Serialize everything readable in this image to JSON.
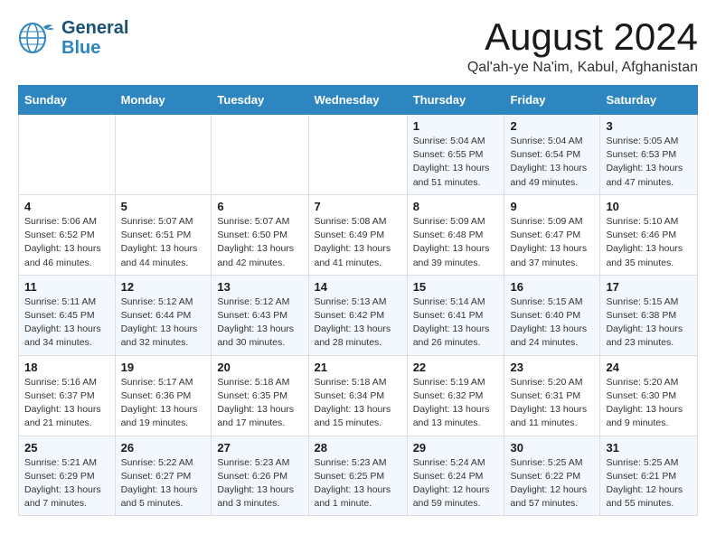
{
  "logo": {
    "line1": "General",
    "line2": "Blue"
  },
  "title": "August 2024",
  "location": "Qal'ah-ye Na'im, Kabul, Afghanistan",
  "weekdays": [
    "Sunday",
    "Monday",
    "Tuesday",
    "Wednesday",
    "Thursday",
    "Friday",
    "Saturday"
  ],
  "weeks": [
    [
      {
        "day": "",
        "info": ""
      },
      {
        "day": "",
        "info": ""
      },
      {
        "day": "",
        "info": ""
      },
      {
        "day": "",
        "info": ""
      },
      {
        "day": "1",
        "info": "Sunrise: 5:04 AM\nSunset: 6:55 PM\nDaylight: 13 hours\nand 51 minutes."
      },
      {
        "day": "2",
        "info": "Sunrise: 5:04 AM\nSunset: 6:54 PM\nDaylight: 13 hours\nand 49 minutes."
      },
      {
        "day": "3",
        "info": "Sunrise: 5:05 AM\nSunset: 6:53 PM\nDaylight: 13 hours\nand 47 minutes."
      }
    ],
    [
      {
        "day": "4",
        "info": "Sunrise: 5:06 AM\nSunset: 6:52 PM\nDaylight: 13 hours\nand 46 minutes."
      },
      {
        "day": "5",
        "info": "Sunrise: 5:07 AM\nSunset: 6:51 PM\nDaylight: 13 hours\nand 44 minutes."
      },
      {
        "day": "6",
        "info": "Sunrise: 5:07 AM\nSunset: 6:50 PM\nDaylight: 13 hours\nand 42 minutes."
      },
      {
        "day": "7",
        "info": "Sunrise: 5:08 AM\nSunset: 6:49 PM\nDaylight: 13 hours\nand 41 minutes."
      },
      {
        "day": "8",
        "info": "Sunrise: 5:09 AM\nSunset: 6:48 PM\nDaylight: 13 hours\nand 39 minutes."
      },
      {
        "day": "9",
        "info": "Sunrise: 5:09 AM\nSunset: 6:47 PM\nDaylight: 13 hours\nand 37 minutes."
      },
      {
        "day": "10",
        "info": "Sunrise: 5:10 AM\nSunset: 6:46 PM\nDaylight: 13 hours\nand 35 minutes."
      }
    ],
    [
      {
        "day": "11",
        "info": "Sunrise: 5:11 AM\nSunset: 6:45 PM\nDaylight: 13 hours\nand 34 minutes."
      },
      {
        "day": "12",
        "info": "Sunrise: 5:12 AM\nSunset: 6:44 PM\nDaylight: 13 hours\nand 32 minutes."
      },
      {
        "day": "13",
        "info": "Sunrise: 5:12 AM\nSunset: 6:43 PM\nDaylight: 13 hours\nand 30 minutes."
      },
      {
        "day": "14",
        "info": "Sunrise: 5:13 AM\nSunset: 6:42 PM\nDaylight: 13 hours\nand 28 minutes."
      },
      {
        "day": "15",
        "info": "Sunrise: 5:14 AM\nSunset: 6:41 PM\nDaylight: 13 hours\nand 26 minutes."
      },
      {
        "day": "16",
        "info": "Sunrise: 5:15 AM\nSunset: 6:40 PM\nDaylight: 13 hours\nand 24 minutes."
      },
      {
        "day": "17",
        "info": "Sunrise: 5:15 AM\nSunset: 6:38 PM\nDaylight: 13 hours\nand 23 minutes."
      }
    ],
    [
      {
        "day": "18",
        "info": "Sunrise: 5:16 AM\nSunset: 6:37 PM\nDaylight: 13 hours\nand 21 minutes."
      },
      {
        "day": "19",
        "info": "Sunrise: 5:17 AM\nSunset: 6:36 PM\nDaylight: 13 hours\nand 19 minutes."
      },
      {
        "day": "20",
        "info": "Sunrise: 5:18 AM\nSunset: 6:35 PM\nDaylight: 13 hours\nand 17 minutes."
      },
      {
        "day": "21",
        "info": "Sunrise: 5:18 AM\nSunset: 6:34 PM\nDaylight: 13 hours\nand 15 minutes."
      },
      {
        "day": "22",
        "info": "Sunrise: 5:19 AM\nSunset: 6:32 PM\nDaylight: 13 hours\nand 13 minutes."
      },
      {
        "day": "23",
        "info": "Sunrise: 5:20 AM\nSunset: 6:31 PM\nDaylight: 13 hours\nand 11 minutes."
      },
      {
        "day": "24",
        "info": "Sunrise: 5:20 AM\nSunset: 6:30 PM\nDaylight: 13 hours\nand 9 minutes."
      }
    ],
    [
      {
        "day": "25",
        "info": "Sunrise: 5:21 AM\nSunset: 6:29 PM\nDaylight: 13 hours\nand 7 minutes."
      },
      {
        "day": "26",
        "info": "Sunrise: 5:22 AM\nSunset: 6:27 PM\nDaylight: 13 hours\nand 5 minutes."
      },
      {
        "day": "27",
        "info": "Sunrise: 5:23 AM\nSunset: 6:26 PM\nDaylight: 13 hours\nand 3 minutes."
      },
      {
        "day": "28",
        "info": "Sunrise: 5:23 AM\nSunset: 6:25 PM\nDaylight: 13 hours\nand 1 minute."
      },
      {
        "day": "29",
        "info": "Sunrise: 5:24 AM\nSunset: 6:24 PM\nDaylight: 12 hours\nand 59 minutes."
      },
      {
        "day": "30",
        "info": "Sunrise: 5:25 AM\nSunset: 6:22 PM\nDaylight: 12 hours\nand 57 minutes."
      },
      {
        "day": "31",
        "info": "Sunrise: 5:25 AM\nSunset: 6:21 PM\nDaylight: 12 hours\nand 55 minutes."
      }
    ]
  ]
}
